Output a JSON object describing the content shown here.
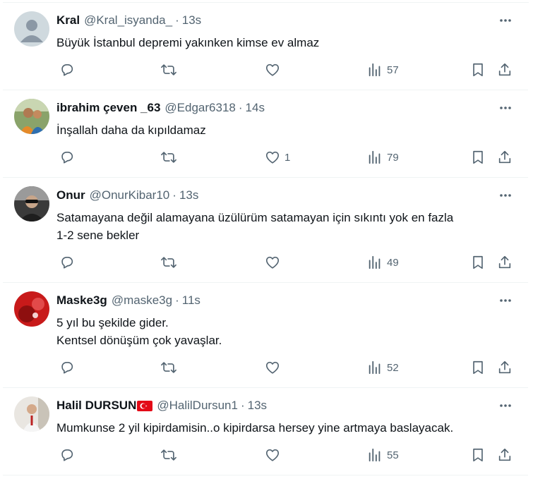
{
  "tweets": [
    {
      "name": "Kral",
      "handle": "@Kral_isyanda_",
      "separator": "·",
      "time": "13s",
      "lines": [
        "Büyük İstanbul depremi yakınken kimse ev almaz"
      ],
      "likes": "",
      "views": "57",
      "has_flag": false
    },
    {
      "name": "ibrahim çeven _63",
      "handle": "@Edgar6318",
      "separator": "·",
      "time": "14s",
      "lines": [
        "İnşallah daha da kıpıldamaz"
      ],
      "likes": "1",
      "views": "79",
      "has_flag": false
    },
    {
      "name": "Onur",
      "handle": "@OnurKibar10",
      "separator": "·",
      "time": "13s",
      "lines": [
        "Satamayana değil alamayana üzülürüm satamayan için sıkıntı yok en fazla",
        "1-2 sene bekler"
      ],
      "likes": "",
      "views": "49",
      "has_flag": false
    },
    {
      "name": "Maske3g",
      "handle": "@maske3g",
      "separator": "·",
      "time": "11s",
      "lines": [
        "5 yıl bu şekilde gider.",
        "Kentsel dönüşüm çok yavaşlar."
      ],
      "likes": "",
      "views": "52",
      "has_flag": false
    },
    {
      "name": "Halil DURSUN",
      "handle": "@HalilDursun1",
      "separator": "·",
      "time": "13s",
      "lines": [
        "Mumkunse 2 yil kipirdamisin..o kipirdarsa hersey yine artmaya baslayacak."
      ],
      "likes": "",
      "views": "55",
      "has_flag": true
    }
  ],
  "colors": {
    "text": "#0f1419",
    "muted": "#536471",
    "divider": "#eff3f4",
    "flag_red": "#e30a17"
  },
  "icons": {
    "reply": "reply-icon",
    "retweet": "retweet-icon",
    "like": "heart-icon",
    "views": "views-icon",
    "bookmark": "bookmark-icon",
    "share": "share-icon",
    "more": "more-options-icon"
  }
}
